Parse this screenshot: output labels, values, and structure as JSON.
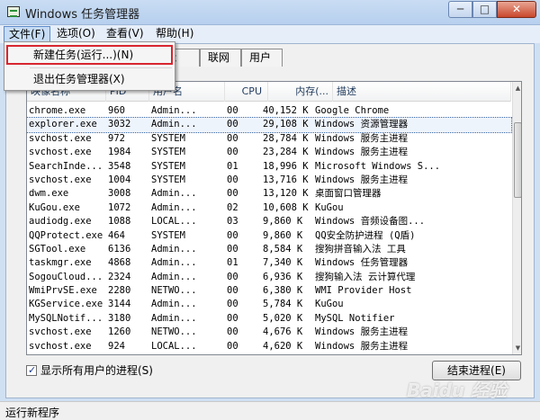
{
  "window": {
    "title": "Windows 任务管理器",
    "min_label": "─",
    "max_label": "□",
    "close_label": "✕",
    "app_icon": "task-manager-icon"
  },
  "menubar": {
    "file": "文件(F)",
    "options": "选项(O)",
    "view": "查看(V)",
    "help": "帮助(H)"
  },
  "file_menu": {
    "new_task": "新建任务(运行...)(N)",
    "exit": "退出任务管理器(X)"
  },
  "tabs": {
    "a": "",
    "b": "",
    "c": "",
    "performance_partial": "能",
    "network": "联网",
    "users": "用户"
  },
  "columns": {
    "name": "映像名称",
    "pid": "PID",
    "user": "用户名",
    "cpu": "CPU",
    "mem": "内存(...",
    "desc": "描述"
  },
  "processes": [
    {
      "name": "chrome.exe",
      "pid": "960",
      "user": "Admin...",
      "cpu": "00",
      "mem": "40,152 K",
      "desc": "Google Chrome"
    },
    {
      "name": "explorer.exe",
      "pid": "3032",
      "user": "Admin...",
      "cpu": "00",
      "mem": "29,108 K",
      "desc": "Windows 资源管理器",
      "selected": true
    },
    {
      "name": "svchost.exe",
      "pid": "972",
      "user": "SYSTEM",
      "cpu": "00",
      "mem": "28,784 K",
      "desc": "Windows 服务主进程"
    },
    {
      "name": "svchost.exe",
      "pid": "1984",
      "user": "SYSTEM",
      "cpu": "00",
      "mem": "23,284 K",
      "desc": "Windows 服务主进程"
    },
    {
      "name": "SearchInde...",
      "pid": "3548",
      "user": "SYSTEM",
      "cpu": "01",
      "mem": "18,996 K",
      "desc": "Microsoft Windows S..."
    },
    {
      "name": "svchost.exe",
      "pid": "1004",
      "user": "SYSTEM",
      "cpu": "00",
      "mem": "13,716 K",
      "desc": "Windows 服务主进程"
    },
    {
      "name": "dwm.exe",
      "pid": "3008",
      "user": "Admin...",
      "cpu": "00",
      "mem": "13,120 K",
      "desc": "桌面窗口管理器"
    },
    {
      "name": "KuGou.exe",
      "pid": "1072",
      "user": "Admin...",
      "cpu": "02",
      "mem": "10,608 K",
      "desc": "KuGou"
    },
    {
      "name": "audiodg.exe",
      "pid": "1088",
      "user": "LOCAL...",
      "cpu": "03",
      "mem": "9,860 K",
      "desc": "Windows 音频设备图..."
    },
    {
      "name": "QQProtect.exe",
      "pid": "464",
      "user": "SYSTEM",
      "cpu": "00",
      "mem": "9,860 K",
      "desc": "QQ安全防护进程 (Q盾)"
    },
    {
      "name": "SGTool.exe",
      "pid": "6136",
      "user": "Admin...",
      "cpu": "00",
      "mem": "8,584 K",
      "desc": "搜狗拼音输入法 工具"
    },
    {
      "name": "taskmgr.exe",
      "pid": "4868",
      "user": "Admin...",
      "cpu": "01",
      "mem": "7,340 K",
      "desc": "Windows 任务管理器"
    },
    {
      "name": "SogouCloud...",
      "pid": "2324",
      "user": "Admin...",
      "cpu": "00",
      "mem": "6,936 K",
      "desc": "搜狗输入法 云计算代理"
    },
    {
      "name": "WmiPrvSE.exe",
      "pid": "2280",
      "user": "NETWO...",
      "cpu": "00",
      "mem": "6,380 K",
      "desc": "WMI Provider Host"
    },
    {
      "name": "KGService.exe",
      "pid": "3144",
      "user": "Admin...",
      "cpu": "00",
      "mem": "5,784 K",
      "desc": "KuGou"
    },
    {
      "name": "MySQLNotif...",
      "pid": "3180",
      "user": "Admin...",
      "cpu": "00",
      "mem": "5,020 K",
      "desc": "MySQL Notifier"
    },
    {
      "name": "svchost.exe",
      "pid": "1260",
      "user": "NETWO...",
      "cpu": "00",
      "mem": "4,676 K",
      "desc": "Windows 服务主进程"
    },
    {
      "name": "svchost.exe",
      "pid": "924",
      "user": "LOCAL...",
      "cpu": "00",
      "mem": "4,620 K",
      "desc": "Windows 服务主进程"
    }
  ],
  "footer": {
    "show_all_label": "显示所有用户的进程(S)",
    "show_all_checked": true,
    "end_process": "结束进程(E)"
  },
  "statusbar": {
    "text": "运行新程序"
  },
  "watermark": "Baidu 经验",
  "colors": {
    "highlight_border": "#d8262f",
    "menu_selected": "#c7dcf5"
  }
}
